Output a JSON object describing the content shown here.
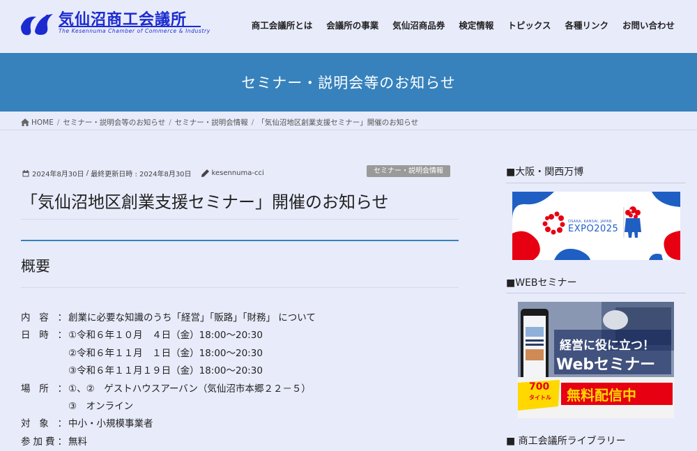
{
  "header": {
    "logo_title": "気仙沼商工会議所",
    "logo_subtitle": "The Kesennuma Chamber of Commerce & Industry",
    "nav": [
      {
        "label": "商工会議所とは"
      },
      {
        "label": "会議所の事業"
      },
      {
        "label": "気仙沼商品券"
      },
      {
        "label": "検定情報"
      },
      {
        "label": "トピックス"
      },
      {
        "label": "各種リンク"
      },
      {
        "label": "お問い合わせ"
      }
    ]
  },
  "banner": {
    "title": "セミナー・説明会等のお知らせ"
  },
  "breadcrumb": {
    "home": "HOME",
    "items": [
      "セミナー・説明会等のお知らせ",
      "セミナー・説明会情報",
      "「気仙沼地区創業支援セミナー」開催のお知らせ"
    ]
  },
  "post": {
    "published": "2024年8月30日",
    "updated": "最終更新日時 : 2024年8月30日",
    "author": "kesennuma-cci",
    "category": "セミナー・説明会情報",
    "title": "「気仙沼地区創業支援セミナー」開催のお知らせ",
    "section_heading": "概要",
    "details": [
      {
        "label": [
          "内",
          "容"
        ],
        "value": "創業に必要な知識のうち「経営」「販路」「財務」 について"
      },
      {
        "label": [
          "日",
          "時"
        ],
        "value": "①令和６年１０月　４日（金）18:00～20:30"
      },
      {
        "label": [],
        "value": "②令和６年１１月　１日（金）18:00～20:30"
      },
      {
        "label": [],
        "value": "③令和６年１１月１９日（金）18:00～20:30"
      },
      {
        "label": [
          "場",
          "所"
        ],
        "value": "①、②　ゲストハウスアーバン（気仙沼市本郷２２－５）"
      },
      {
        "label": [],
        "value": "③　オンライン"
      },
      {
        "label": [
          "対",
          "象"
        ],
        "value": "中小・小規模事業者"
      },
      {
        "label": [
          "参",
          "加",
          "費"
        ],
        "value": "無料"
      }
    ]
  },
  "sidebar": {
    "expo_heading": "■大阪・関西万博",
    "expo_banner": {
      "small": "OSAKA, KANSAI, JAPAN",
      "big": "EXPO2025"
    },
    "web_heading": "■WEBセミナー",
    "web_banner": {
      "line1": "経営に役に立つ！",
      "line2": "Webセミナー",
      "count": "700",
      "count_unit": "タイトル",
      "cta": "無料配信中"
    },
    "library_heading": "■ 商工会議所ライブラリー"
  },
  "colors": {
    "accent": "#3782bd",
    "logo_blue": "#1b2bd0",
    "background": "#e8ebfa",
    "badge": "#9a9a9a"
  }
}
